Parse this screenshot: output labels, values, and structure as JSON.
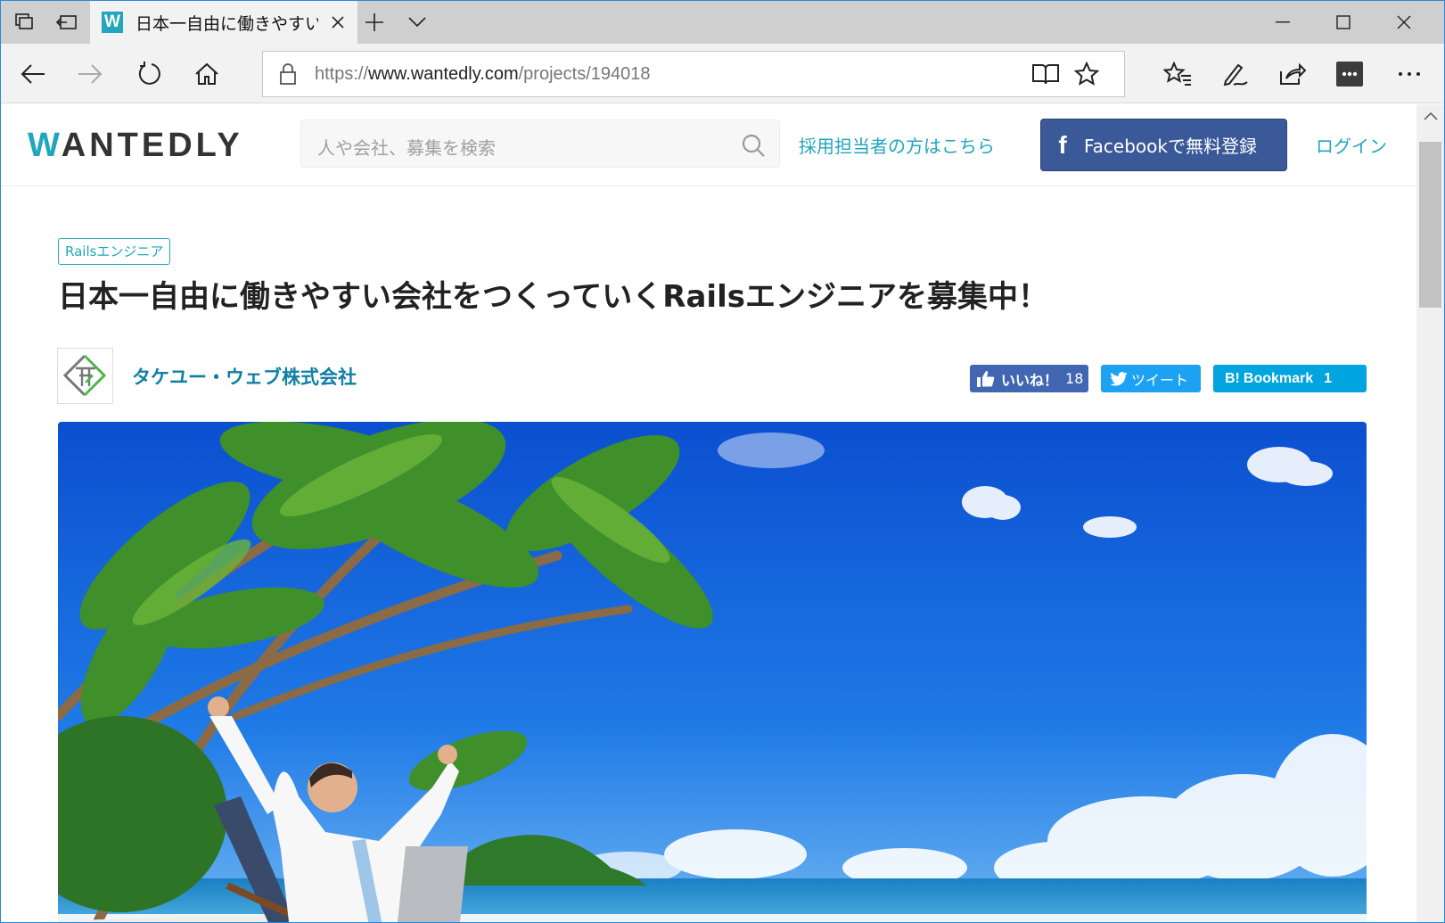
{
  "browser": {
    "tab_title": "日本一自由に働きやすい会",
    "favicon_letter": "W",
    "url_prefix": "https://",
    "url_host": "www.wantedly.com",
    "url_path": "/projects/194018"
  },
  "site": {
    "logo_first": "W",
    "logo_rest": "ANTEDLY",
    "search_placeholder": "人や会社、募集を検索",
    "recruit_link": "採用担当者の方はこちら",
    "facebook_icon": "f",
    "facebook_button": "Facebookで無料登録",
    "login": "ログイン"
  },
  "project": {
    "tag": "Railsエンジニア",
    "title": "日本一自由に働きやすい会社をつくっていくRailsエンジニアを募集中！",
    "company": "タケユー・ウェブ株式会社",
    "share": {
      "like_label": "いいね！",
      "like_count": "18",
      "tweet_label": "ツイート",
      "bookmark_icon": "B!",
      "bookmark_label": "Bookmark",
      "bookmark_count": "1"
    }
  },
  "colors": {
    "brand": "#21a6bd",
    "facebook": "#3b5998",
    "twitter": "#1da1f2",
    "hatena": "#00a4de"
  }
}
